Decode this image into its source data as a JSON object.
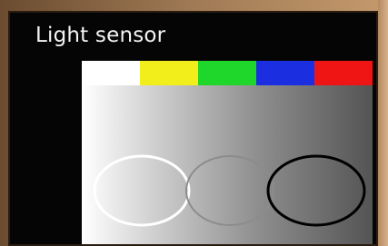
{
  "screen": {
    "title": "Light sensor"
  },
  "swatches": [
    {
      "name": "white",
      "color": "#ffffff"
    },
    {
      "name": "yellow",
      "color": "#f2ee1c"
    },
    {
      "name": "green",
      "color": "#1fd62a"
    },
    {
      "name": "blue",
      "color": "#1b2fe0"
    },
    {
      "name": "red",
      "color": "#f01515"
    }
  ],
  "rings": [
    {
      "name": "white-ring",
      "color": "#ffffff"
    },
    {
      "name": "gray-ring",
      "color": "#8c8c8c"
    },
    {
      "name": "black-ring",
      "color": "#000000"
    }
  ]
}
